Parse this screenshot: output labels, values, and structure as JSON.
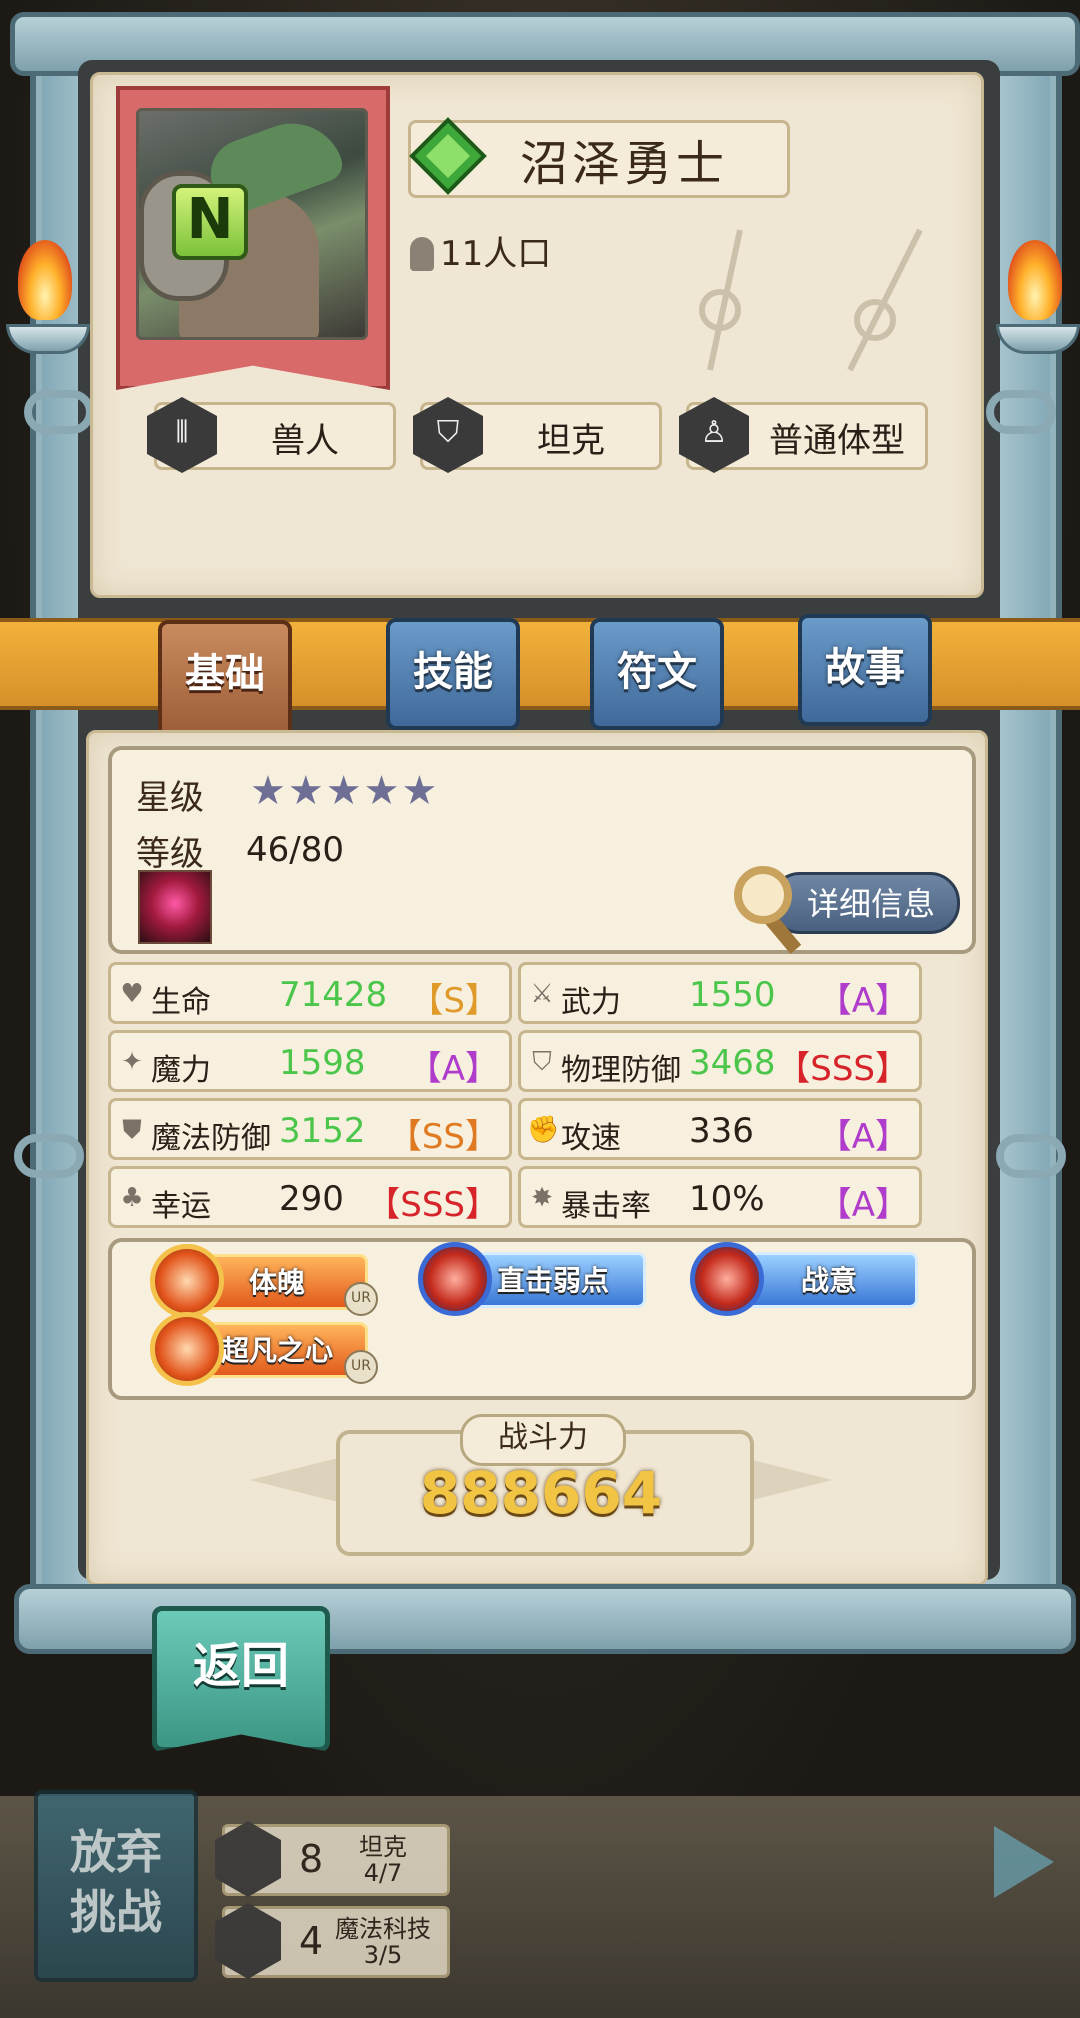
{
  "hero": {
    "name": "沼泽勇士",
    "rarity": "N",
    "population": "11人口"
  },
  "traits": [
    {
      "icon": "claw-icon",
      "label": "兽人"
    },
    {
      "icon": "shield-icon",
      "label": "坦克"
    },
    {
      "icon": "body-icon",
      "label": "普通体型"
    }
  ],
  "tabs": [
    {
      "label": "基础",
      "active": true
    },
    {
      "label": "技能",
      "active": false
    },
    {
      "label": "符文",
      "active": false
    },
    {
      "label": "故事",
      "active": false
    }
  ],
  "basic": {
    "star_label": "星级",
    "stars": "★★★★★",
    "star_count": 5,
    "level_label": "等级",
    "level_value": "46/80",
    "detail_button": "详细信息"
  },
  "stats": [
    {
      "icon": "heart-icon",
      "name": "生命",
      "value": "71428",
      "grade": "【S】",
      "grade_class": "g-S",
      "value_color": "green"
    },
    {
      "icon": "sword-icon",
      "name": "武力",
      "value": "1550",
      "grade": "【A】",
      "grade_class": "g-A",
      "value_color": "green"
    },
    {
      "icon": "sparkle-icon",
      "name": "魔力",
      "value": "1598",
      "grade": "【A】",
      "grade_class": "g-A",
      "value_color": "green"
    },
    {
      "icon": "armor-icon",
      "name": "物理防御",
      "value": "3468",
      "grade": "【SSS】",
      "grade_class": "g-SSS",
      "value_color": "green"
    },
    {
      "icon": "magic-shield-icon",
      "name": "魔法防御",
      "value": "3152",
      "grade": "【SS】",
      "grade_class": "g-SS",
      "value_color": "green"
    },
    {
      "icon": "fist-icon",
      "name": "攻速",
      "value": "336",
      "grade": "【A】",
      "grade_class": "g-A",
      "value_color": "dark"
    },
    {
      "icon": "clover-icon",
      "name": "幸运",
      "value": "290",
      "grade": "【SSS】",
      "grade_class": "g-SSS",
      "value_color": "dark"
    },
    {
      "icon": "burst-icon",
      "name": "暴击率",
      "value": "10%",
      "grade": "【A】",
      "grade_class": "g-A",
      "value_color": "dark"
    }
  ],
  "talents": [
    {
      "label": "体魄",
      "style": "orange",
      "badge": "UR"
    },
    {
      "label": "直击弱点",
      "style": "blue"
    },
    {
      "label": "战意",
      "style": "blue"
    },
    {
      "label": "超凡之心",
      "style": "orange",
      "badge": "UR"
    }
  ],
  "power": {
    "label": "战斗力",
    "value": "888664"
  },
  "back_button": "返回",
  "bottom": {
    "abandon_line1": "放弃",
    "abandon_line2": "挑战",
    "synergies": [
      {
        "count": "8",
        "name": "坦克",
        "progress": "4/7"
      },
      {
        "count": "4",
        "name": "魔法科技",
        "progress": "3/5"
      }
    ]
  },
  "colors": {
    "accent_gold": "#f2b23a",
    "tab_blue": "#40699a",
    "tab_active": "#9a5a36",
    "stat_green": "#4bc64b",
    "grade_sss": "#d6242a"
  }
}
